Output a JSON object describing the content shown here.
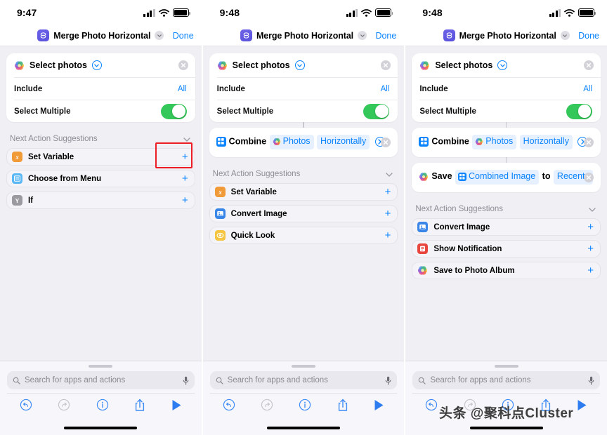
{
  "colors": {
    "accent": "#0A84FF",
    "toggle_on": "#34C759",
    "highlight": "#EE1C25",
    "background": "#F0EFF4",
    "card": "#FFFFFF",
    "muted_text": "#8E8D96"
  },
  "panels": [
    {
      "id": "panel-1",
      "status": {
        "time": "9:47",
        "signal_icon": "cellular-signal-icon",
        "wifi_icon": "wifi-icon",
        "battery_icon": "battery-icon"
      },
      "nav": {
        "app_icon": "shortcuts-app-icon",
        "title": "Merge Photo Horizontal",
        "chevron_icon": "chevron-down-icon",
        "done_label": "Done"
      },
      "action_card": {
        "icon": "photos-app-icon",
        "title": "Select photos",
        "disclosure_icon": "chevron-down-circle-icon",
        "close_icon": "close-circle-icon",
        "rows": [
          {
            "label": "Include",
            "value": "All",
            "type": "value"
          },
          {
            "label": "Select Multiple",
            "value": "on",
            "type": "toggle",
            "highlighted": true
          }
        ]
      },
      "token_cards": [],
      "suggestions": {
        "title": "Next Action Suggestions",
        "collapse_icon": "chevron-down-icon",
        "items": [
          {
            "label": "Set Variable",
            "icon": "variable-icon",
            "icon_color": "#F09A38",
            "glyph": "x",
            "add_icon": "plus-icon"
          },
          {
            "label": "Choose from Menu",
            "icon": "menu-icon",
            "icon_color": "#5BB8F5",
            "glyph": "▤",
            "add_icon": "plus-icon"
          },
          {
            "label": "If",
            "icon": "if-icon",
            "icon_color": "#9A9AA0",
            "glyph": "Y",
            "add_icon": "plus-icon"
          }
        ]
      },
      "sheet": {
        "grabber": "sheet-grabber",
        "search_icon": "search-icon",
        "search_placeholder": "Search for apps and actions",
        "mic_icon": "microphone-icon"
      },
      "toolbar": {
        "undo": "undo-icon",
        "redo": "redo-icon",
        "info": "info-icon",
        "share": "share-icon",
        "play": "play-icon",
        "redo_disabled": true
      },
      "watermark": ""
    },
    {
      "id": "panel-2",
      "status": {
        "time": "9:48",
        "signal_icon": "cellular-signal-icon",
        "wifi_icon": "wifi-icon",
        "battery_icon": "battery-icon"
      },
      "nav": {
        "app_icon": "shortcuts-app-icon",
        "title": "Merge Photo Horizontal",
        "chevron_icon": "chevron-down-icon",
        "done_label": "Done"
      },
      "action_card": {
        "icon": "photos-app-icon",
        "title": "Select photos",
        "disclosure_icon": "chevron-down-circle-icon",
        "close_icon": "close-circle-icon",
        "rows": [
          {
            "label": "Include",
            "value": "All",
            "type": "value"
          },
          {
            "label": "Select Multiple",
            "value": "on",
            "type": "toggle",
            "highlighted": false
          }
        ]
      },
      "token_cards": [
        {
          "name": "combine-images-card",
          "icon": "combine-images-icon",
          "close_icon": "close-circle-icon",
          "tokens": [
            {
              "type": "text",
              "text": "Combine"
            },
            {
              "type": "chip",
              "text": "Photos",
              "icon": "photos-app-icon"
            },
            {
              "type": "chip",
              "text": "Horizontally"
            },
            {
              "type": "arrow",
              "icon": "chevron-right-circle-icon"
            }
          ]
        }
      ],
      "suggestions": {
        "title": "Next Action Suggestions",
        "collapse_icon": "chevron-down-icon",
        "items": [
          {
            "label": "Set Variable",
            "icon": "variable-icon",
            "icon_color": "#F09A38",
            "glyph": "x",
            "add_icon": "plus-icon"
          },
          {
            "label": "Convert Image",
            "icon": "convert-image-icon",
            "icon_color": "#3A86E8",
            "glyph": "▣",
            "add_icon": "plus-icon"
          },
          {
            "label": "Quick Look",
            "icon": "quick-look-icon",
            "icon_color": "#F5C542",
            "glyph": "◉",
            "add_icon": "plus-icon"
          }
        ]
      },
      "sheet": {
        "grabber": "sheet-grabber",
        "search_icon": "search-icon",
        "search_placeholder": "Search for apps and actions",
        "mic_icon": "microphone-icon"
      },
      "toolbar": {
        "undo": "undo-icon",
        "redo": "redo-icon",
        "info": "info-icon",
        "share": "share-icon",
        "play": "play-icon",
        "redo_disabled": true
      },
      "watermark": ""
    },
    {
      "id": "panel-3",
      "status": {
        "time": "9:48",
        "signal_icon": "cellular-signal-icon",
        "wifi_icon": "wifi-icon",
        "battery_icon": "battery-icon"
      },
      "nav": {
        "app_icon": "shortcuts-app-icon",
        "title": "Merge Photo Horizontal",
        "chevron_icon": "chevron-down-icon",
        "done_label": "Done"
      },
      "action_card": {
        "icon": "photos-app-icon",
        "title": "Select photos",
        "disclosure_icon": "chevron-down-circle-icon",
        "close_icon": "close-circle-icon",
        "rows": [
          {
            "label": "Include",
            "value": "All",
            "type": "value"
          },
          {
            "label": "Select Multiple",
            "value": "on",
            "type": "toggle",
            "highlighted": false
          }
        ]
      },
      "token_cards": [
        {
          "name": "combine-images-card",
          "icon": "combine-images-icon",
          "close_icon": "close-circle-icon",
          "tokens": [
            {
              "type": "text",
              "text": "Combine"
            },
            {
              "type": "chip",
              "text": "Photos",
              "icon": "photos-app-icon"
            },
            {
              "type": "chip",
              "text": "Horizontally"
            },
            {
              "type": "arrow",
              "icon": "chevron-right-circle-icon"
            }
          ]
        },
        {
          "name": "save-to-album-card",
          "icon": "photos-app-icon",
          "close_icon": "close-circle-icon",
          "tokens": [
            {
              "type": "text",
              "text": "Save"
            },
            {
              "type": "chip",
              "text": "Combined Image",
              "icon": "combine-images-icon"
            },
            {
              "type": "text",
              "text": "to"
            },
            {
              "type": "chip",
              "text": "Recents"
            }
          ]
        }
      ],
      "suggestions": {
        "title": "Next Action Suggestions",
        "collapse_icon": "chevron-down-icon",
        "items": [
          {
            "label": "Convert Image",
            "icon": "convert-image-icon",
            "icon_color": "#3A86E8",
            "glyph": "▣",
            "add_icon": "plus-icon"
          },
          {
            "label": "Show Notification",
            "icon": "notification-icon",
            "icon_color": "#E8453C",
            "glyph": "⚑",
            "add_icon": "plus-icon"
          },
          {
            "label": "Save to Photo Album",
            "icon": "photos-app-icon",
            "icon_color": "",
            "glyph": "",
            "add_icon": "plus-icon"
          }
        ]
      },
      "sheet": {
        "grabber": "sheet-grabber",
        "search_icon": "search-icon",
        "search_placeholder": "Search for apps and actions",
        "mic_icon": "microphone-icon"
      },
      "toolbar": {
        "undo": "undo-icon",
        "redo": "redo-icon",
        "info": "info-icon",
        "share": "share-icon",
        "play": "play-icon",
        "redo_disabled": true
      },
      "watermark": "头条 @聚科点Cluster"
    }
  ]
}
